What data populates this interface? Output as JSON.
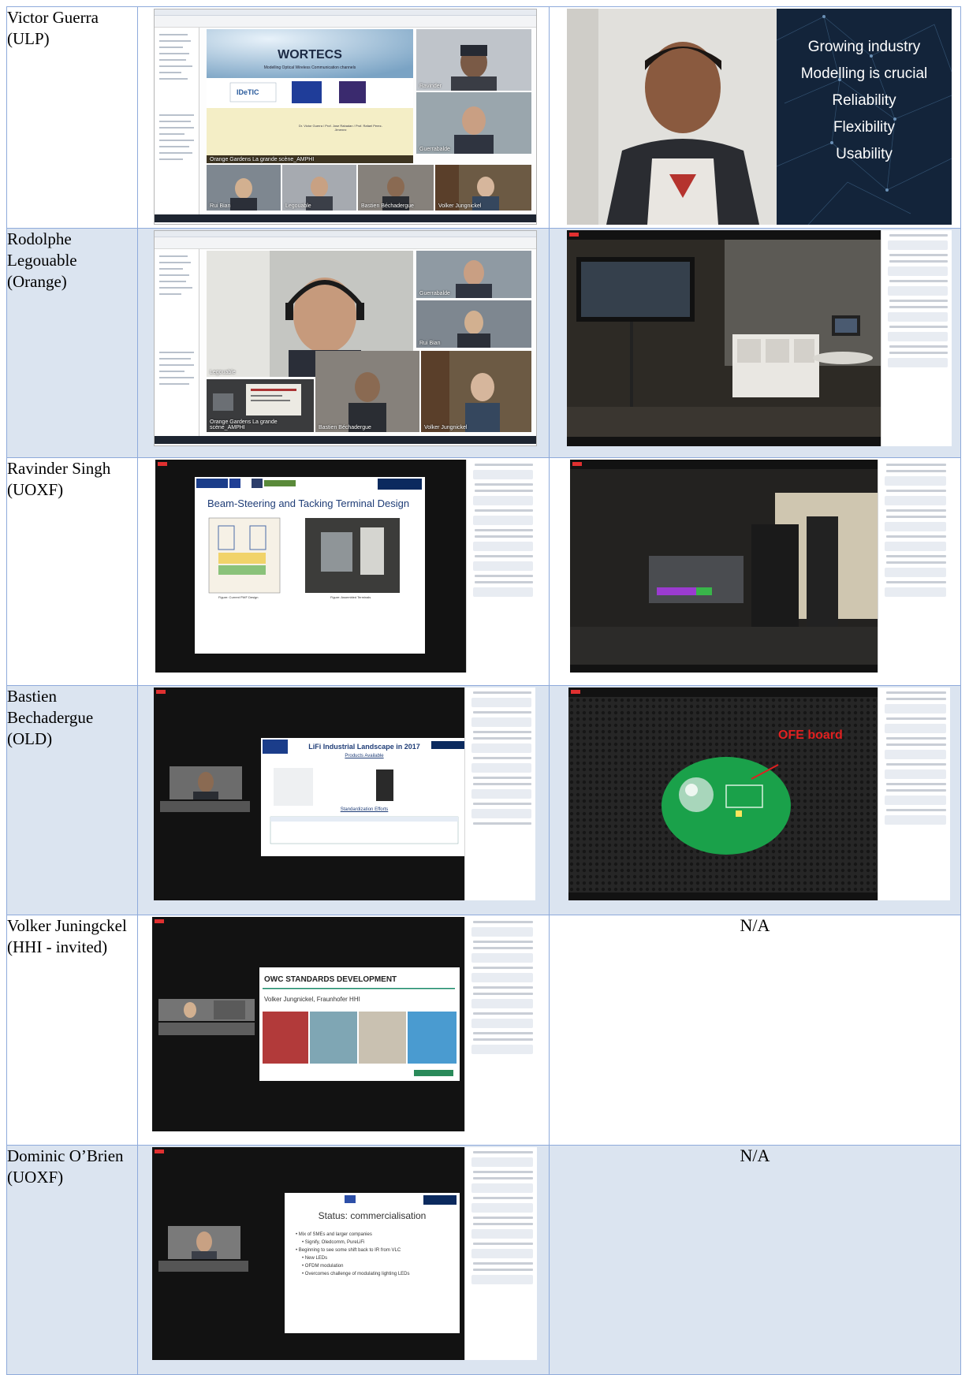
{
  "rows": [
    {
      "name": "Victor Guerra (ULP)",
      "right": "image",
      "screen": {
        "slide_title": "WORTECS",
        "slide_subtitle": "Modelling Optical Wireless Communication channels",
        "slide_logo": "IDeTIC",
        "slide_authors": "Dr. Victor Guerra / Prof. Jose Rabadan / Prof. Rafael Perez-Jimenez",
        "tiles": [
          "Ravinder",
          "Orange Gardens La grande scène_AMPHI",
          "Rui Bian",
          "Legouable",
          "Bastien Béchadergue",
          "Volker Jungnickel",
          "Guerrabalde"
        ]
      },
      "overlay": [
        "Growing industry",
        "Modelling is crucial",
        "Reliability",
        "Flexibility",
        "Usability"
      ]
    },
    {
      "name": "Rodolphe Legouable (Orange)",
      "right": "image",
      "screen": {
        "tiles": [
          "Legouable",
          "Orange Gardens La grande scène_AMPHI",
          "Bastien Béchadergue",
          "Volker Jungnickel",
          "Guerrabalde",
          "Rui Bian"
        ]
      }
    },
    {
      "name": "Ravinder Singh (UOXF)",
      "right": "image",
      "screen": {
        "slide_title": "Beam-Steering and Tacking Terminal Design",
        "slide_org": "OXFORD",
        "fig_left": "Figure: Current PWF Design",
        "fig_right": "Figure: Assembled Terminals"
      }
    },
    {
      "name": "Bastien Bechadergue (OLD)",
      "right": "image",
      "screen": {
        "slide_title": "LiFi Industrial Landscape in 2017",
        "products": "Products Available",
        "standard": "Standardization Efforts"
      },
      "overlay_label": "OFE board"
    },
    {
      "name": "Volker Juningckel (HHI - invited)",
      "right": "na",
      "screen": {
        "slide_title": "OWC STANDARDS DEVELOPMENT",
        "slide_author": "Volker Jungnickel, Fraunhofer HHI"
      }
    },
    {
      "name": "Dominic O’Brien (UOXF)",
      "right": "na",
      "screen": {
        "slide_title": "Status: commercialisation",
        "bullets": [
          "Mix of SMEs and larger companies",
          "Signify, Oledcomm, PureLiFi",
          "Beginning to see some shift back to IR from VLC",
          "New LEDs",
          "OFDM modulation",
          "Overcomes challenge of modulating lighting LEDs"
        ]
      }
    }
  ],
  "na_text": "N/A",
  "colors": {
    "border": "#8eaadb",
    "shade": "#dbe4f0",
    "ofe_red": "#e02020",
    "board_green": "#1aa14a"
  }
}
